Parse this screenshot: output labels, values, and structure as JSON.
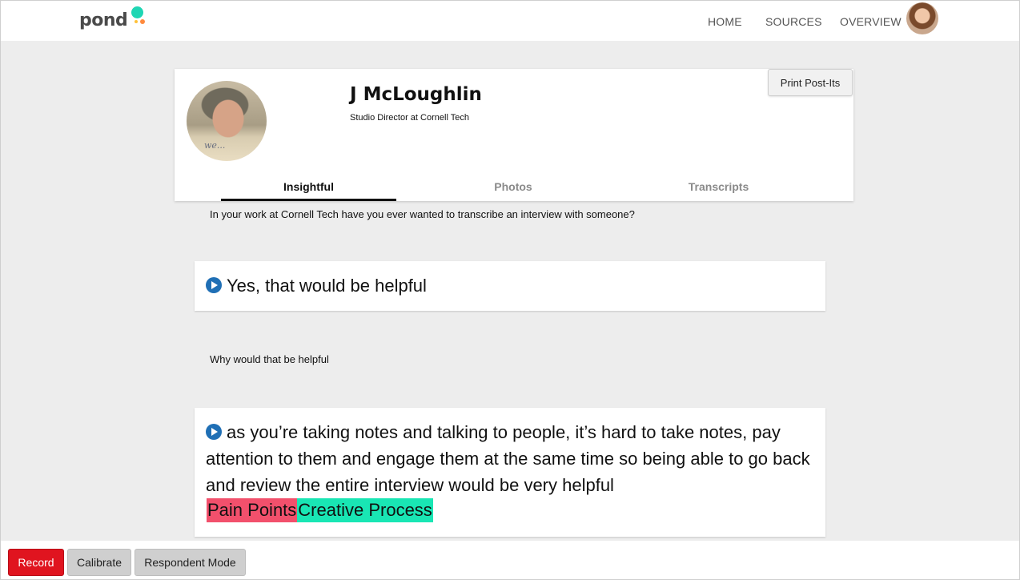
{
  "header": {
    "logo_text": "pond",
    "nav": [
      {
        "label": "HOME"
      },
      {
        "label": "SOURCES"
      },
      {
        "label": "OVERVIEW"
      }
    ]
  },
  "profile": {
    "name": "J McLoughlin",
    "title": "Studio Director at Cornell Tech",
    "photo_caption": "we...",
    "print_label": "Print Post-Its",
    "tabs": [
      {
        "label": "Insightful",
        "active": true
      },
      {
        "label": "Photos",
        "active": false
      },
      {
        "label": "Transcripts",
        "active": false
      }
    ]
  },
  "transcript": {
    "q1": "In your work at Cornell Tech have you ever wanted to transcribe an interview with someone?",
    "a1": "Yes, that would be helpful",
    "q2": "Why would that be helpful",
    "a2": "as you’re taking notes and talking to people, it’s hard to take notes, pay attention to them and engage them at the same time so being able to go back and review the entire interview would be very helpful",
    "tags": [
      {
        "label": "Pain Points",
        "color": "#f2506c"
      },
      {
        "label": "Creative Process",
        "color": "#19e6b4"
      }
    ]
  },
  "footer": {
    "record_label": "Record",
    "calibrate_label": "Calibrate",
    "respondent_label": "Respondent Mode"
  },
  "colors": {
    "accent_blue": "#1f6fb5",
    "record_red": "#e0141f"
  }
}
